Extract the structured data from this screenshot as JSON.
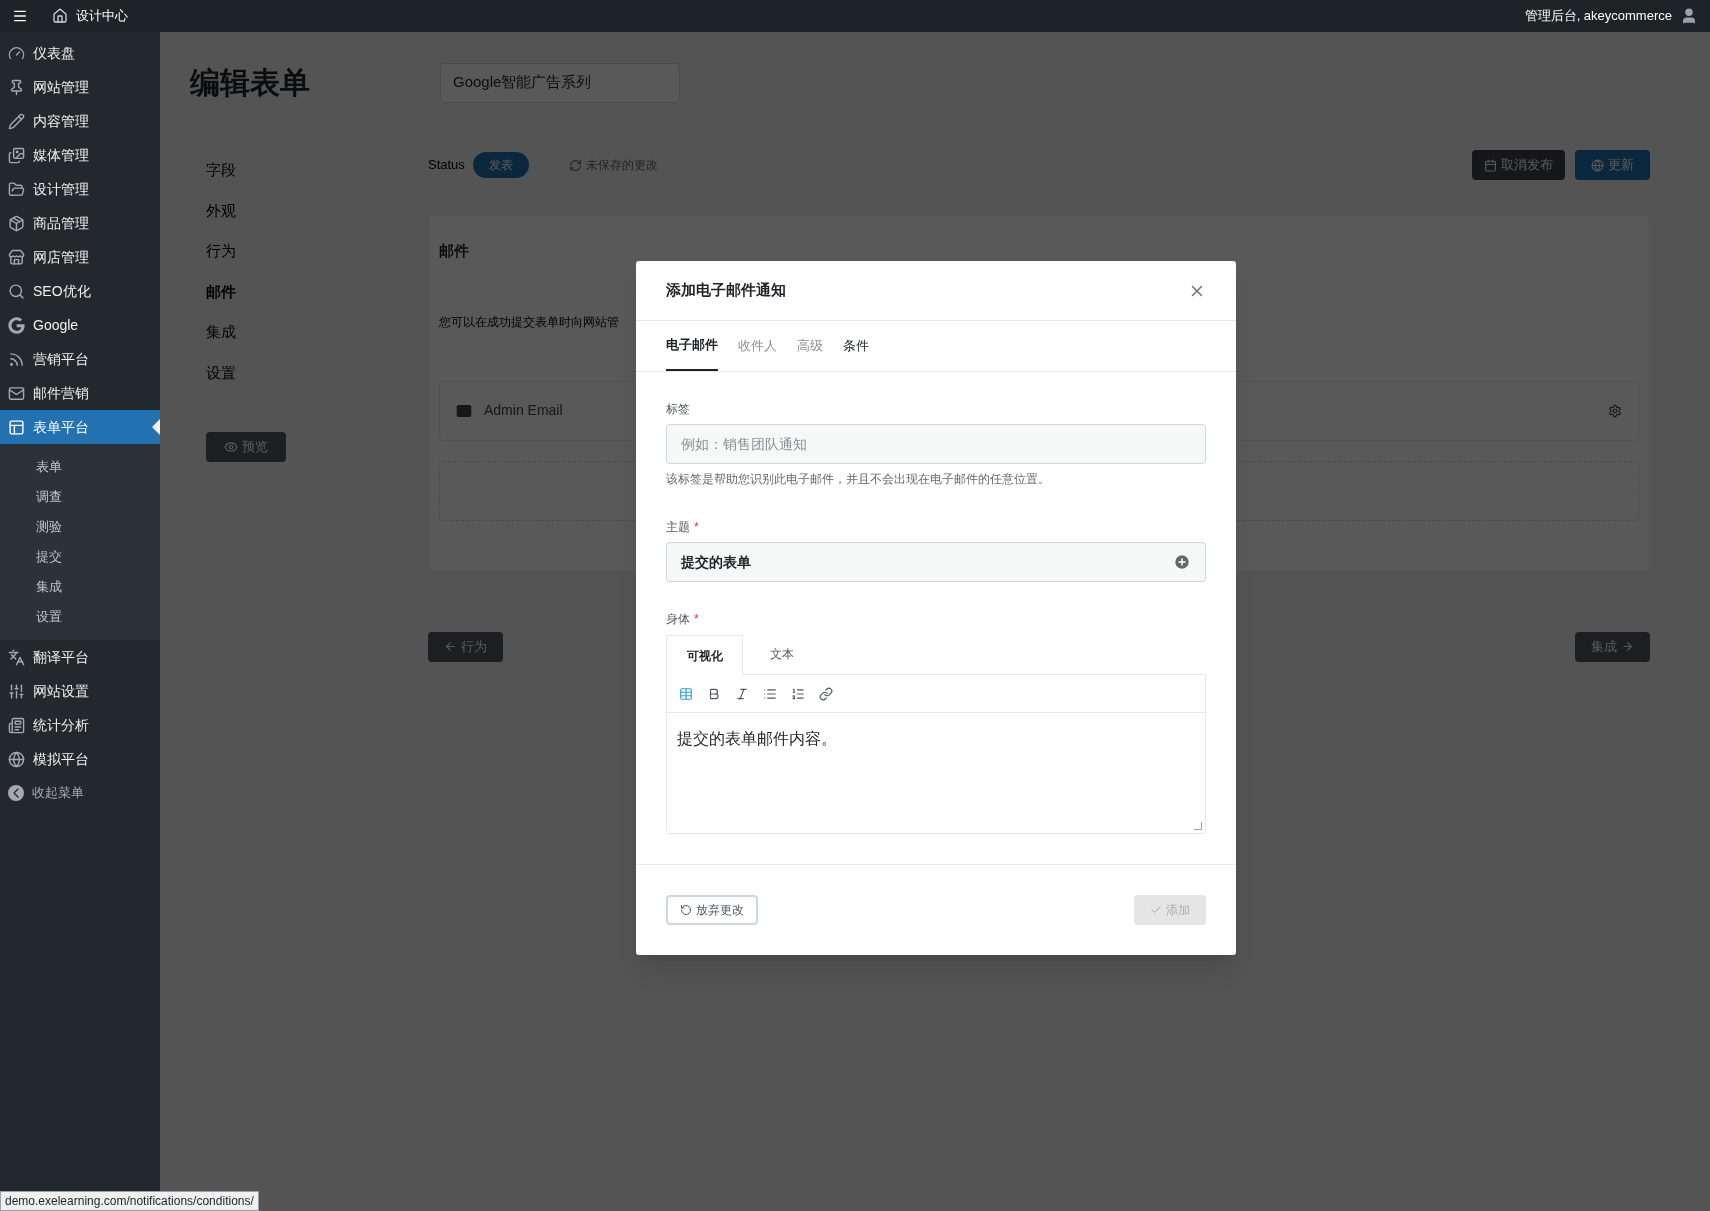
{
  "topbar": {
    "site_name": "设计中心",
    "account": "管理后台, akeycommerce"
  },
  "sidebar": {
    "items": [
      {
        "label": "仪表盘",
        "selected": false
      },
      {
        "label": "网站管理",
        "selected": false
      },
      {
        "label": "内容管理",
        "selected": false
      },
      {
        "label": "媒体管理",
        "selected": false
      },
      {
        "label": "设计管理",
        "selected": false
      },
      {
        "label": "商品管理",
        "selected": false
      },
      {
        "label": "网店管理",
        "selected": false
      },
      {
        "label": "SEO优化",
        "selected": false
      },
      {
        "label": "Google",
        "selected": false
      },
      {
        "label": "营销平台",
        "selected": false
      },
      {
        "label": "邮件营销",
        "selected": false
      },
      {
        "label": "表单平台",
        "selected": true,
        "children": [
          {
            "label": "表单"
          },
          {
            "label": "调查"
          },
          {
            "label": "测验"
          },
          {
            "label": "提交"
          },
          {
            "label": "集成"
          },
          {
            "label": "设置"
          }
        ]
      },
      {
        "label": "翻译平台",
        "selected": false
      },
      {
        "label": "网站设置",
        "selected": false
      },
      {
        "label": "统计分析",
        "selected": false
      },
      {
        "label": "模拟平台",
        "selected": false
      }
    ],
    "collapse": "收起菜单"
  },
  "page": {
    "title": "编辑表单",
    "form_name": "Google智能广告系列",
    "nav": [
      {
        "label": "字段",
        "selected": false
      },
      {
        "label": "外观",
        "selected": false
      },
      {
        "label": "行为",
        "selected": false
      },
      {
        "label": "邮件",
        "selected": true
      },
      {
        "label": "集成",
        "selected": false
      },
      {
        "label": "设置",
        "selected": false
      }
    ],
    "preview": "预览",
    "status_label": "Status",
    "status_toggle": {
      "label": "发表",
      "on": true
    },
    "unsaved": "未保存的更改",
    "unpublish": "取消发布",
    "update": "更新",
    "section_title": "邮件",
    "description": "您可以在成功提交表单时向网站管",
    "notification": "Admin Email",
    "back": "行为",
    "next": "集成"
  },
  "dialog": {
    "title": "添加电子邮件通知",
    "tabs": [
      {
        "label": "电子邮件",
        "selected": true,
        "hovered": false
      },
      {
        "label": "收件人",
        "selected": false,
        "hovered": false
      },
      {
        "label": "高级",
        "selected": false,
        "hovered": false
      },
      {
        "label": "条件",
        "selected": false,
        "hovered": true
      }
    ],
    "label_field": {
      "label": "标签",
      "placeholder": "例如：销售团队通知",
      "help": "该标签是帮助您识别此电子邮件，并且不会出现在电子邮件的任意位置。"
    },
    "subject_field": {
      "label": "主题",
      "required_mark": "*",
      "value": "提交的表单"
    },
    "body_field": {
      "label": "身体",
      "required_mark": "*",
      "editor_tabs": [
        {
          "label": "可视化",
          "selected": true
        },
        {
          "label": "文本",
          "selected": false
        }
      ],
      "content": "提交的表单邮件内容。"
    },
    "discard": "放弃更改",
    "add": {
      "label": "添加",
      "disabled": true
    }
  },
  "status_url": "demo.exelearning.com/notifications/conditions/"
}
